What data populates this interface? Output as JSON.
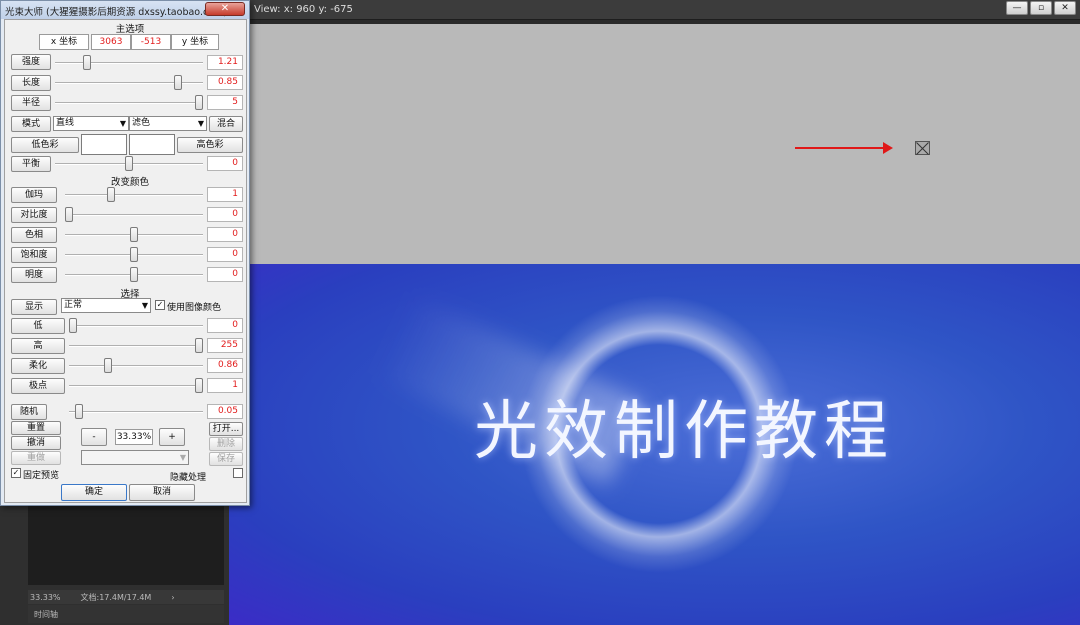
{
  "host": {
    "view_readout": "View:  x: 960  y: -675",
    "status_zoom": "33.33%",
    "status_doc": "文档:17.4M/17.4M",
    "status_chevron": "›",
    "timeline_label": "时间轴",
    "win_controls": [
      "—",
      "▫",
      "✕"
    ]
  },
  "canvas": {
    "title_text": "光效制作教程",
    "arrow_color": "#e01818"
  },
  "dialog": {
    "title": "光束大师 (大猩猩摄影后期资源 dxssy.taobao.com)",
    "close_label": "✕",
    "main_section": "主选项",
    "x_coord_label": "x 坐标",
    "x_coord_value": "3063",
    "y_coord_value": "-513",
    "y_coord_label": "y 坐标",
    "rows_top": [
      {
        "label": "强度",
        "value": "1.21",
        "level": 0.2
      },
      {
        "label": "长度",
        "value": "0.85",
        "level": 0.85
      },
      {
        "label": "半径",
        "value": "5",
        "level": 1.0
      }
    ],
    "mode_label": "模式",
    "mode_select_1": "直线",
    "mode_select_2": "滤色",
    "blend_button": "混合",
    "low_color_button": "低色彩",
    "high_color_button": "高色彩",
    "balance": {
      "label": "平衡",
      "value": "0",
      "level": 0.5
    },
    "color_section": "改变颜色",
    "color_rows": [
      {
        "label": "伽玛",
        "value": "1",
        "level": 0.32
      },
      {
        "label": "对比度",
        "value": "0",
        "level": 0.0
      },
      {
        "label": "色相",
        "value": "0",
        "level": 0.5
      },
      {
        "label": "饱和度",
        "value": "0",
        "level": 0.5
      },
      {
        "label": "明度",
        "value": "0",
        "level": 0.5
      }
    ],
    "select_section": "选择",
    "display_label": "显示",
    "display_select": "正常",
    "use_image_color_label": "使用图像颜色",
    "use_image_color_checked": "✓",
    "select_rows": [
      {
        "label": "低",
        "value": "0",
        "level": 0.0
      },
      {
        "label": "高",
        "value": "255",
        "level": 1.0
      },
      {
        "label": "柔化",
        "value": "0.86",
        "level": 0.28
      },
      {
        "label": "极点",
        "value": "1",
        "level": 1.0
      }
    ],
    "random": {
      "label": "随机",
      "value": "0.05",
      "level": 0.05
    },
    "reset_button": "重置",
    "undo_button": "撤消",
    "redo_button": "重做",
    "zoom_minus": "-",
    "zoom_value": "33.33%",
    "zoom_plus": "+",
    "open_button": "打开...",
    "delete_button": "删除",
    "save_button": "保存",
    "preset_select": "",
    "fixed_preview_label": "固定预览",
    "fixed_preview_checked": "✓",
    "hide_processing_label": "隐藏处理",
    "ok_button": "确定",
    "cancel_button": "取消"
  }
}
